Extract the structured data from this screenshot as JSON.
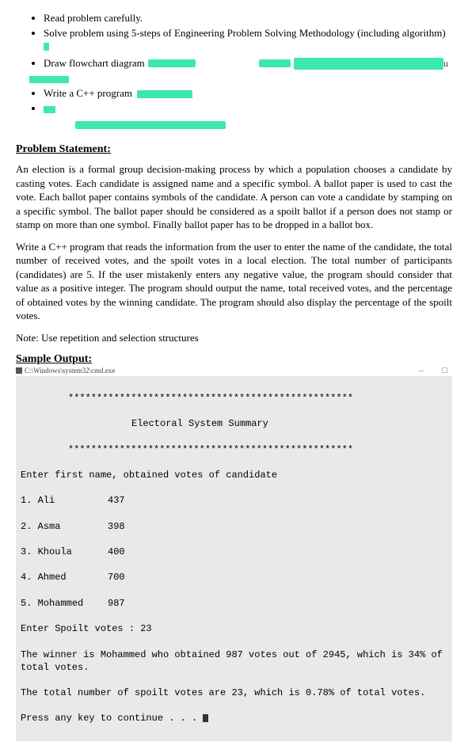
{
  "tasks": {
    "t1": "Read problem carefully.",
    "t2": "Solve problem using 5-steps of Engineering Problem Solving Methodology (including algorithm)",
    "t3": "Draw flowchart diagram",
    "t4": "Write a C++ program"
  },
  "headings": {
    "problem_statement": "Problem Statement:",
    "sample_output": "Sample Output:"
  },
  "paragraphs": {
    "p1": "An election is a formal group decision-making process by which a population chooses a candidate by casting votes. Each candidate is assigned name and a specific symbol. A ballot paper is used to cast the vote. Each ballot paper contains symbols of the candidate. A person can vote a candidate by stamping on a specific symbol. The ballot paper should be considered as a spoilt ballot if a person does not stamp or stamp on more than one symbol. Finally ballot paper has to be dropped in a ballot box.",
    "p2": "Write a C++ program that reads the information from the user to enter the name of the candidate, the total number of received votes, and the spoilt votes in a local election. The total number of participants (candidates) are 5. If the user mistakenly enters any negative value, the program should consider that value as a positive integer. The program should output the name, total received votes, and the percentage of obtained votes by the winning candidate. The program should also display the percentage of the spoilt votes.",
    "note": "Note: Use repetition and selection structures"
  },
  "console_path": "C:\\Windows\\system32\\cmd.exe",
  "right_u": "u",
  "console": {
    "stars1": "**************************************************",
    "title": "Electoral System Summary",
    "stars2": "**************************************************",
    "prompt": "Enter first name, obtained votes of candidate",
    "rows": [
      {
        "idx": "1.",
        "name": "Ali",
        "votes": "437"
      },
      {
        "idx": "2.",
        "name": "Asma",
        "votes": "398"
      },
      {
        "idx": "3.",
        "name": "Khoula",
        "votes": "400"
      },
      {
        "idx": "4.",
        "name": "Ahmed",
        "votes": "700"
      },
      {
        "idx": "5.",
        "name": "Mohammed",
        "votes": "987"
      }
    ],
    "spoilt_line": "Enter Spoilt votes : 23",
    "winner_line": "The winner is Mohammed who obtained 987 votes out of 2945, which is 34% of total votes.",
    "spoilt_total": "The total number of spoilt votes are 23, which is 0.78% of total votes.",
    "press": "Press any key to continue . . . "
  }
}
